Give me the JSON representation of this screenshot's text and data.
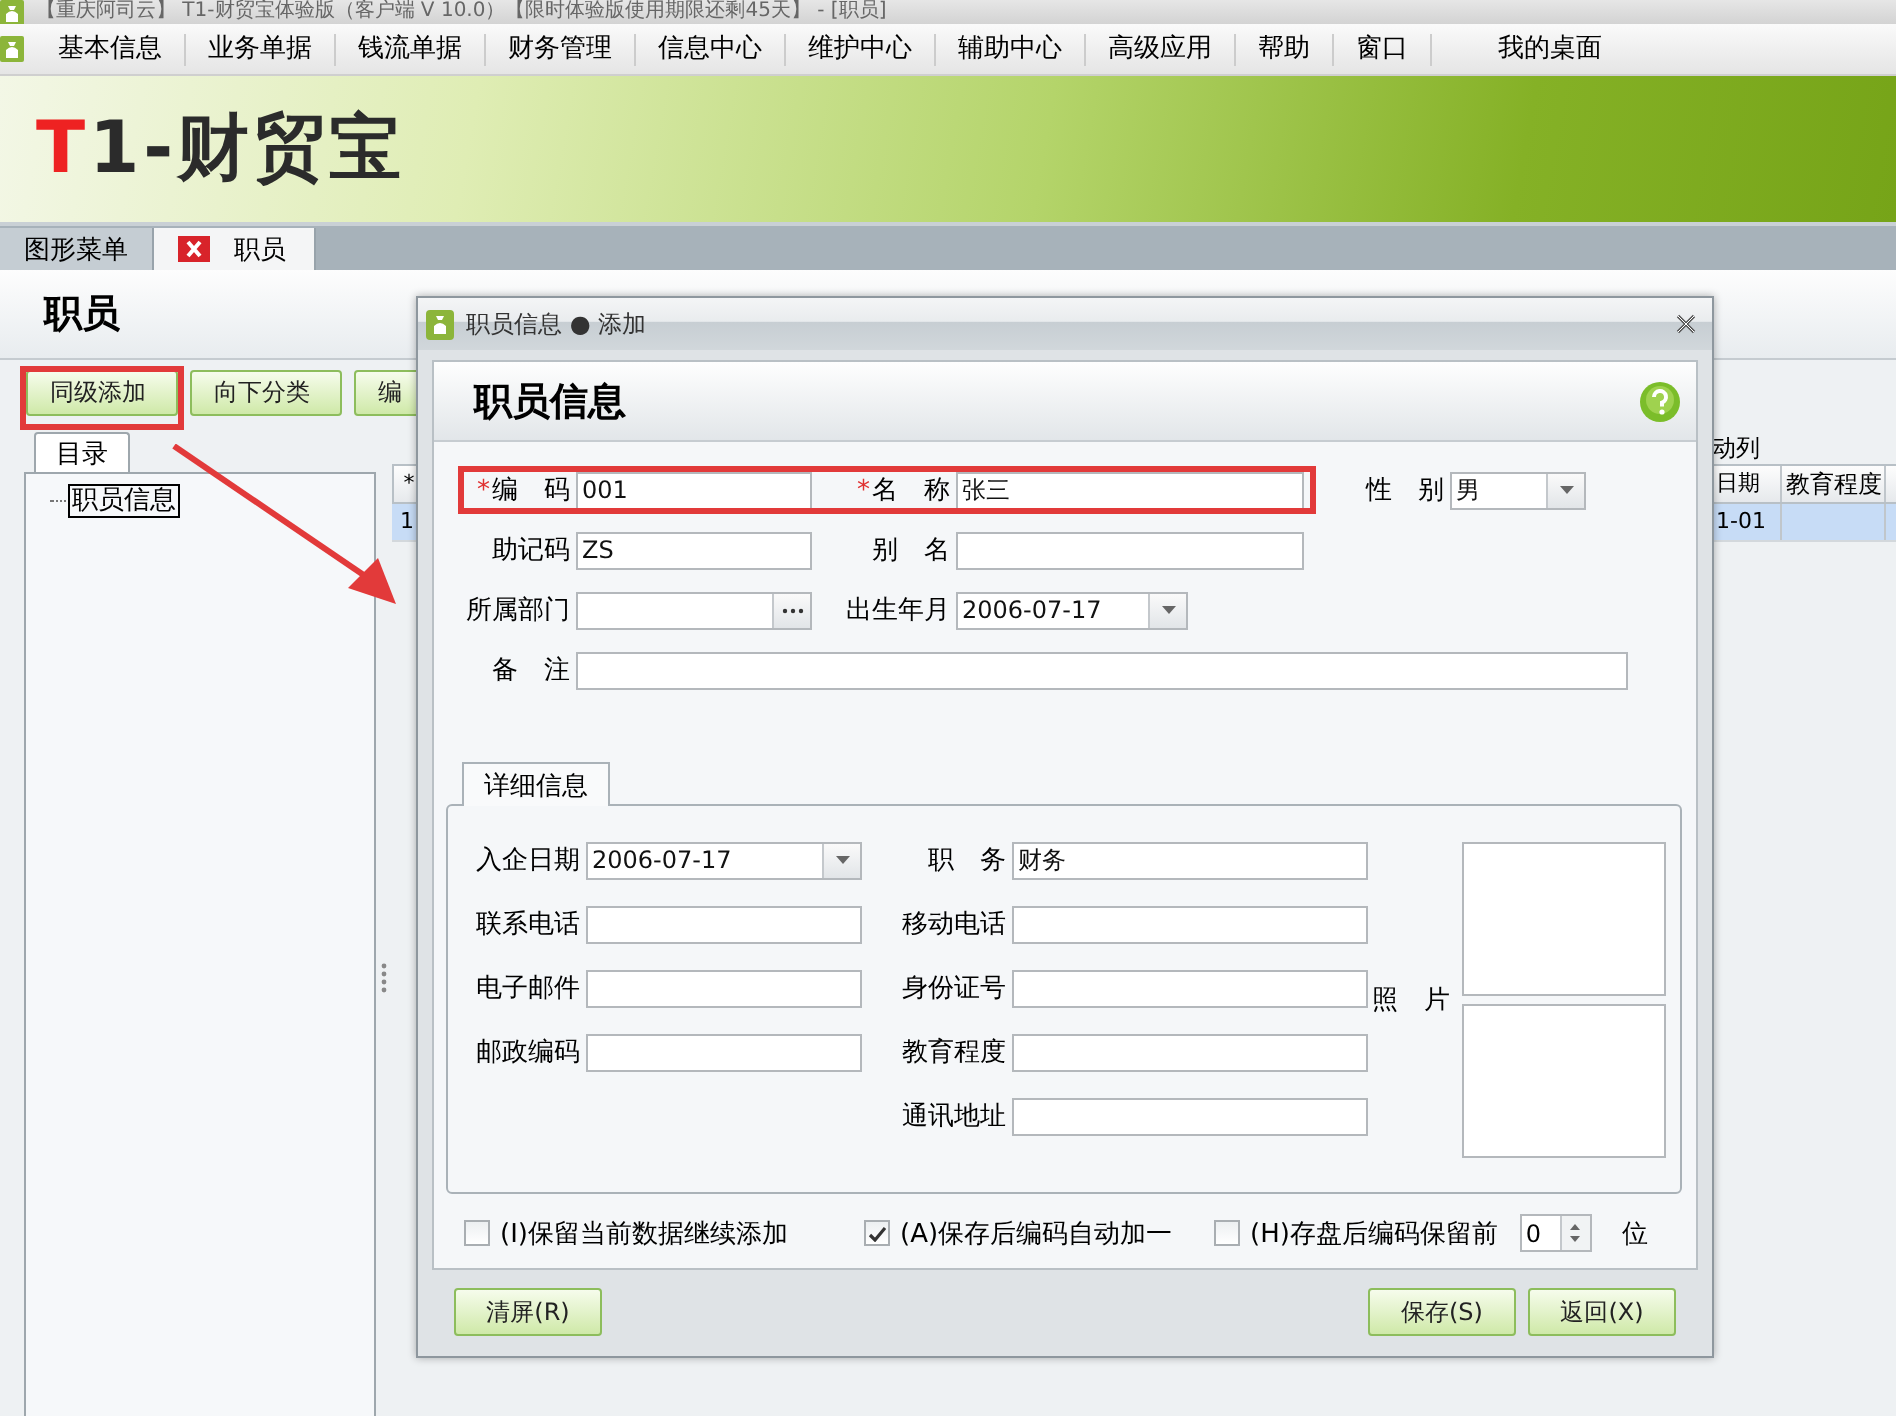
{
  "window": {
    "title": "【重庆阿司云】 T1-财贸宝体验版（客户端 V 10.0）【限时体验版使用期限还剩45天】 - [职员]"
  },
  "menu": [
    "基本信息",
    "业务单据",
    "钱流单据",
    "财务管理",
    "信息中心",
    "维护中心",
    "辅助中心",
    "高级应用",
    "帮助",
    "窗口",
    "我的桌面"
  ],
  "logo": "T1-财贸宝",
  "doc_tabs": [
    {
      "label": "图形菜单",
      "selected": false,
      "closable": false
    },
    {
      "label": "职员",
      "selected": true,
      "closable": true
    }
  ],
  "page": {
    "title": "职员",
    "toolbar": [
      "同级添加",
      "向下分类",
      "编"
    ],
    "tree_tab": "目录",
    "tree": [
      {
        "label": "职员信息",
        "selected": true
      }
    ],
    "grid": {
      "caption": "动列",
      "marker_header": "*",
      "columns": [
        "日期",
        "教育程度"
      ],
      "rows": [
        {
          "marker": "1",
          "cells": [
            "1-01"
          ],
          "selected": true
        }
      ]
    }
  },
  "dialog": {
    "title": "职员信息 ● 添加",
    "heading": "职员信息",
    "fields": [
      [
        {
          "mark": "*",
          "label": "编　码",
          "kind": "text",
          "value": "001"
        },
        {
          "mark": "*",
          "label": "名　称",
          "kind": "text",
          "value": "张三"
        },
        {
          "label": "性　别",
          "kind": "select",
          "value": "男"
        }
      ],
      [
        {
          "label": "助记码",
          "kind": "text",
          "value": "ZS"
        },
        {
          "label": "别　名",
          "kind": "text"
        }
      ],
      [
        {
          "label": "所属部门",
          "kind": "browse"
        },
        {
          "label": "出生年月",
          "kind": "date",
          "value": "2006-07-17"
        }
      ],
      [
        {
          "label": "备　注",
          "kind": "text",
          "wide": true
        }
      ]
    ],
    "detail_tab": "详细信息",
    "detail_rows": [
      {
        "left": {
          "label": "入企日期",
          "kind": "date",
          "value": "2006-07-17"
        },
        "right": {
          "label": "职　务",
          "kind": "text",
          "value": "财务"
        }
      },
      {
        "left": {
          "label": "联系电话",
          "kind": "text"
        },
        "right": {
          "label": "移动电话",
          "kind": "text"
        }
      },
      {
        "left": {
          "label": "电子邮件",
          "kind": "text"
        },
        "right": {
          "label": "身份证号",
          "kind": "text"
        }
      },
      {
        "left": {
          "label": "邮政编码",
          "kind": "text"
        },
        "right": {
          "label": "教育程度",
          "kind": "text"
        }
      },
      {
        "right": {
          "label": "通讯地址",
          "kind": "text"
        }
      }
    ],
    "photo_label": "照　片",
    "options": [
      {
        "label": "(I)保留当前数据继续添加",
        "checked": false
      },
      {
        "label": "(A)保存后编码自动加一",
        "checked": true
      },
      {
        "label": "(H)存盘后编码保留前",
        "checked": false,
        "spin": "0",
        "suffix": "位"
      }
    ],
    "left_buttons": [
      "清屏(R)"
    ],
    "right_buttons": [
      "保存(S)",
      "返回(X)"
    ]
  }
}
